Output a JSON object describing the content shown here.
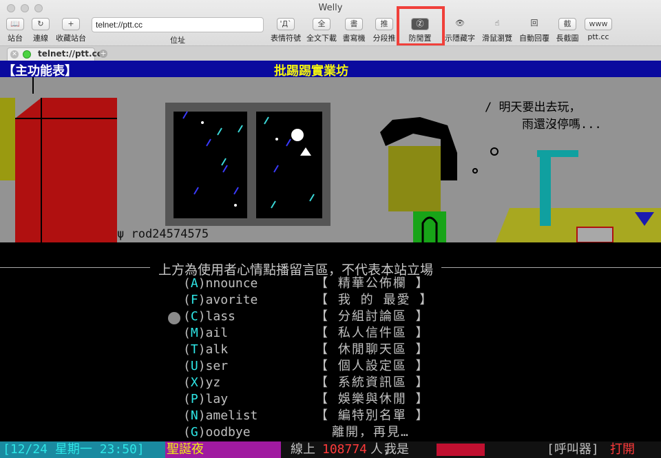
{
  "window": {
    "title": "Welly"
  },
  "toolbar": {
    "items": [
      {
        "label": "站台",
        "icon": "book-icon",
        "glyph": "📖"
      },
      {
        "label": "連線",
        "icon": "reconnect-icon",
        "glyph": "↻"
      },
      {
        "label": "收藏站台",
        "icon": "add-icon",
        "glyph": "+"
      },
      {
        "label": "位址"
      },
      {
        "label": "表情符號",
        "icon": "emoticon-icon",
        "glyph": "'Д`"
      },
      {
        "label": "全文下載",
        "icon": "download-icon",
        "glyph": "全"
      },
      {
        "label": "書寫機",
        "icon": "writer-icon",
        "glyph": "書"
      },
      {
        "label": "分段推",
        "icon": "push-icon",
        "glyph": "推"
      },
      {
        "label": "防閒置",
        "icon": "anti-idle-icon",
        "glyph": "Ⓩ"
      },
      {
        "label": "示隱藏字",
        "icon": "eye-icon",
        "glyph": "👁"
      },
      {
        "label": "滑鼠瀏覽",
        "icon": "mouse-icon",
        "glyph": "☝"
      },
      {
        "label": "自動回覆",
        "icon": "reply-icon",
        "glyph": "回"
      },
      {
        "label": "長截圖",
        "icon": "screenshot-icon",
        "glyph": "截"
      },
      {
        "label": "ptt.cc",
        "icon": "www-icon",
        "glyph": "www"
      }
    ],
    "url_value": "telnet://ptt.cc"
  },
  "tab": {
    "label": "telnet://ptt.cc",
    "close_glyph": "✕",
    "new_glyph": "+"
  },
  "terminal": {
    "header_left": "【主功能表】",
    "header_center": "批踢踢實業坊",
    "bubble_line1": "/ 明天要出去玩，",
    "bubble_line2": "雨還沒停嗎...",
    "signature": "ψ rod24574575",
    "notice": "上方為使用者心情點播留言區，不代表本站立場",
    "menu": [
      {
        "key": "A",
        "rest": "nnounce",
        "desc": "【 精華公佈欄 】"
      },
      {
        "key": "F",
        "rest": "avorite",
        "desc": "【 我 的 最愛 】"
      },
      {
        "key": "C",
        "rest": "lass",
        "desc": "【 分組討論區 】"
      },
      {
        "key": "M",
        "rest": "ail",
        "desc": "【 私人信件區 】"
      },
      {
        "key": "T",
        "rest": "alk",
        "desc": "【 休閒聊天區 】"
      },
      {
        "key": "U",
        "rest": "ser",
        "desc": "【 個人設定區 】"
      },
      {
        "key": "X",
        "rest": "yz",
        "desc": "【 系統資訊區 】"
      },
      {
        "key": "P",
        "rest": "lay",
        "desc": "【 娛樂與休閒 】"
      },
      {
        "key": "N",
        "rest": "amelist",
        "desc": "【 編特別名單 】"
      },
      {
        "key": "G",
        "rest": "oodbye",
        "desc": "離開，再見…"
      }
    ],
    "paren_open": "(",
    "paren_close": ")"
  },
  "status": {
    "date": "[12/24 星期一 23:50]",
    "holiday": "聖誕夜",
    "online_label": "線上",
    "online_count": "108774",
    "online_unit": "人,",
    "me_label": "我是",
    "pager_label": "[呼叫器]",
    "pager_state": "打開"
  },
  "colors": {
    "highlight": "#f0403a",
    "header_bg": "#0a0a9e",
    "menu_key": "#2ee6e6"
  }
}
